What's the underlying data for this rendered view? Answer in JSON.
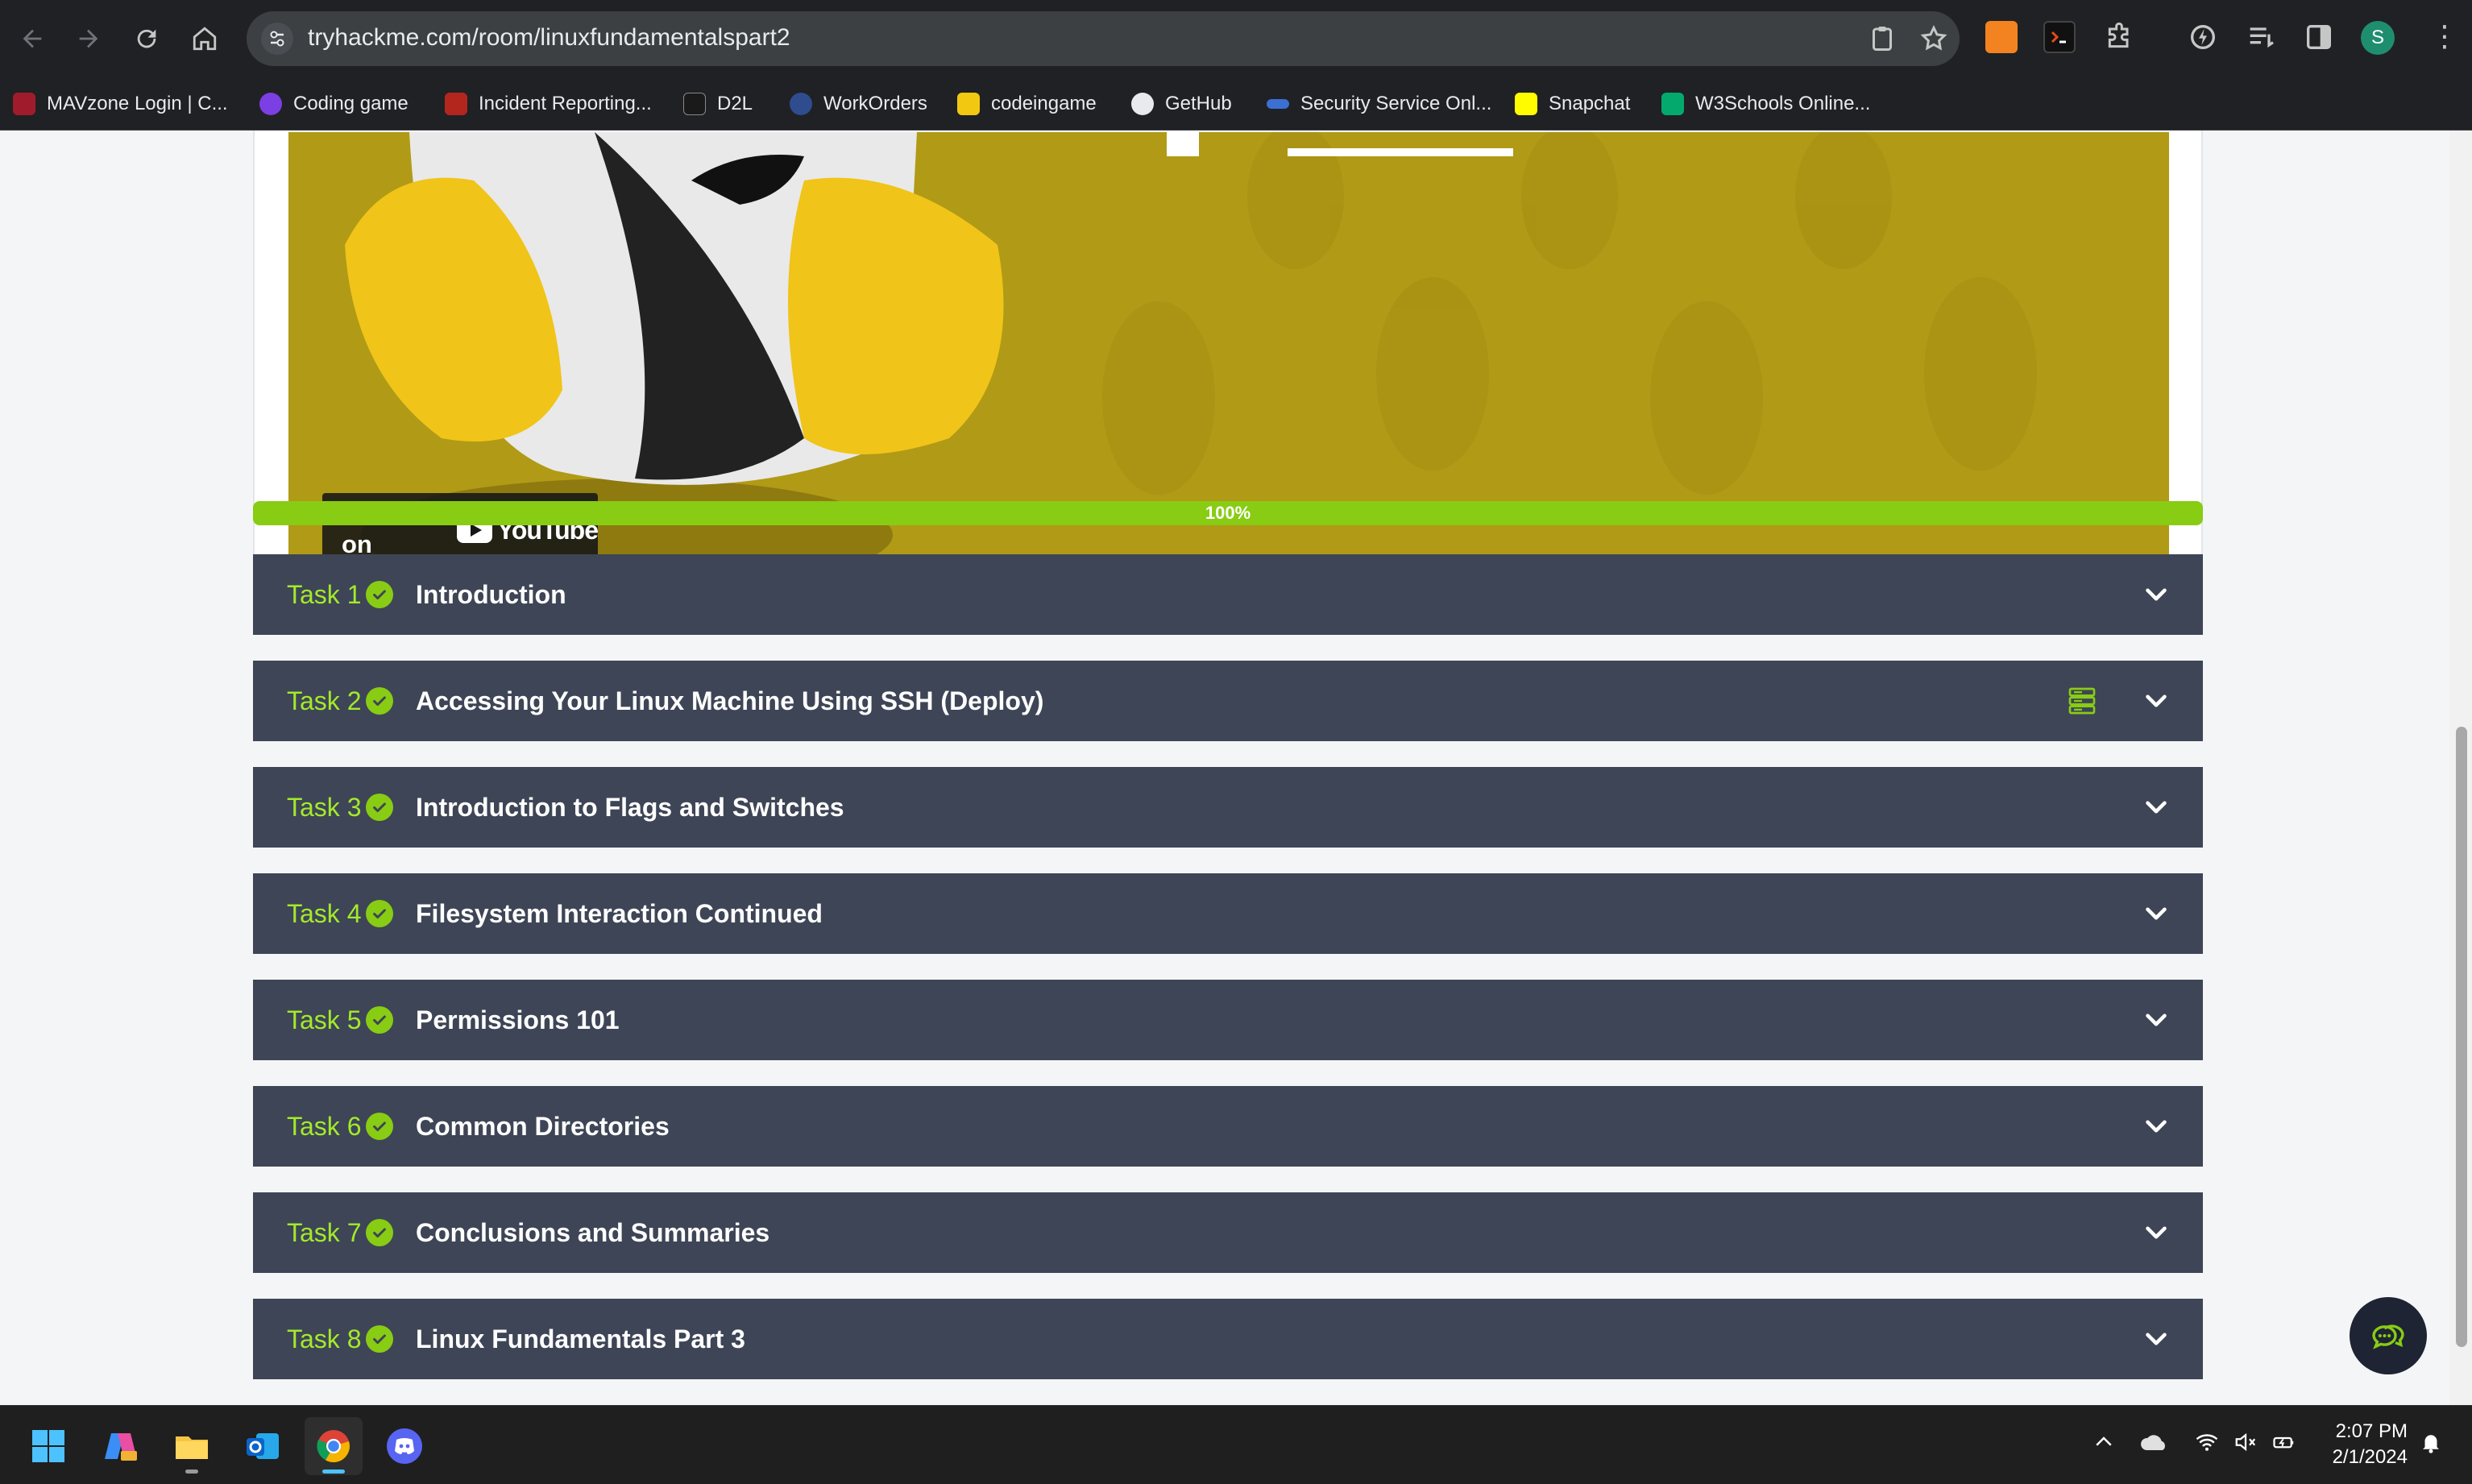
{
  "browser": {
    "url": "tryhackme.com/room/linuxfundamentalspart2",
    "profile_initial": "S",
    "bookmarks": [
      {
        "label": "MAVzone Login | C...",
        "color": "#a01c2c"
      },
      {
        "label": "Coding game",
        "color": "#7b3fe4"
      },
      {
        "label": "Incident Reporting...",
        "color": "#b3261e"
      },
      {
        "label": "D2L",
        "color": "#1a1a1a"
      },
      {
        "label": "WorkOrders",
        "color": "#2f4c8f"
      },
      {
        "label": "codeingame",
        "color": "#f2c811"
      },
      {
        "label": "GetHub",
        "color": "#e8eaed"
      },
      {
        "label": "Security Service Onl...",
        "color": "#3b6fd4"
      },
      {
        "label": "Snapchat",
        "color": "#fffc00"
      },
      {
        "label": "W3Schools Online...",
        "color": "#04aa6d"
      }
    ]
  },
  "video": {
    "watch_label": "Watch on",
    "youtube_label": "YouTube"
  },
  "progress": {
    "label": "100%",
    "value": 1.0
  },
  "tasks": [
    {
      "number": "Task 1",
      "title": "Introduction",
      "completed": true
    },
    {
      "number": "Task 2",
      "title": "Accessing Your Linux Machine Using SSH (Deploy)",
      "completed": true,
      "has_machine": true
    },
    {
      "number": "Task 3",
      "title": "Introduction to Flags and Switches",
      "completed": true
    },
    {
      "number": "Task 4",
      "title": "Filesystem Interaction Continued",
      "completed": true
    },
    {
      "number": "Task 5",
      "title": "Permissions 101",
      "completed": true
    },
    {
      "number": "Task 6",
      "title": "Common Directories",
      "completed": true
    },
    {
      "number": "Task 7",
      "title": "Conclusions and Summaries",
      "completed": true
    },
    {
      "number": "Task 8",
      "title": "Linux Fundamentals Part 3",
      "completed": true
    }
  ],
  "colors": {
    "accent": "#88cc14",
    "task_bg": "#3e4556",
    "task_number": "#a3ea2a"
  },
  "taskbar": {
    "apps": [
      "windows-start-icon",
      "copilot-icon",
      "file-explorer-icon",
      "outlook-icon",
      "chrome-icon",
      "discord-icon"
    ],
    "time": "2:07 PM",
    "date": "2/1/2024"
  }
}
